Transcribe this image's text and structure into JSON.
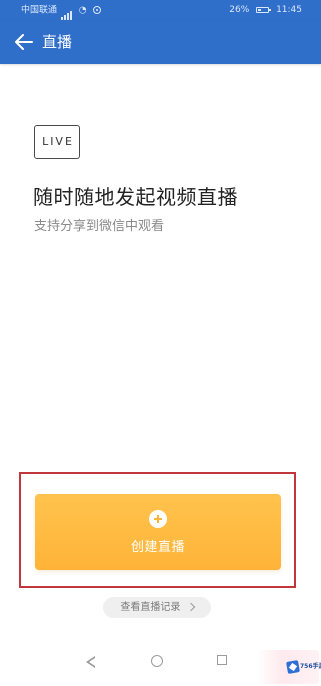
{
  "status_bar": {
    "carrier": "中国联通",
    "battery": "26%",
    "time": "11:45"
  },
  "header": {
    "title": "直播",
    "back_icon": "arrow-left-icon"
  },
  "content": {
    "badge": "LIVE",
    "headline": "随时随地发起视频直播",
    "subheadline": "支持分享到微信中观看"
  },
  "primary_action": {
    "label": "创建直播",
    "icon": "plus-circle-icon"
  },
  "secondary_action": {
    "label": "查看直播记录",
    "icon": "chevron-right-icon"
  },
  "navigation": {
    "back_icon": "triangle-back-icon",
    "home_icon": "circle-home-icon",
    "recents_icon": "square-recents-icon"
  },
  "watermark": {
    "text": "756手游网"
  },
  "colors": {
    "header_blue": "#2f6ec9",
    "button_orange": "#ffb338",
    "highlight_red": "#c1363b"
  }
}
